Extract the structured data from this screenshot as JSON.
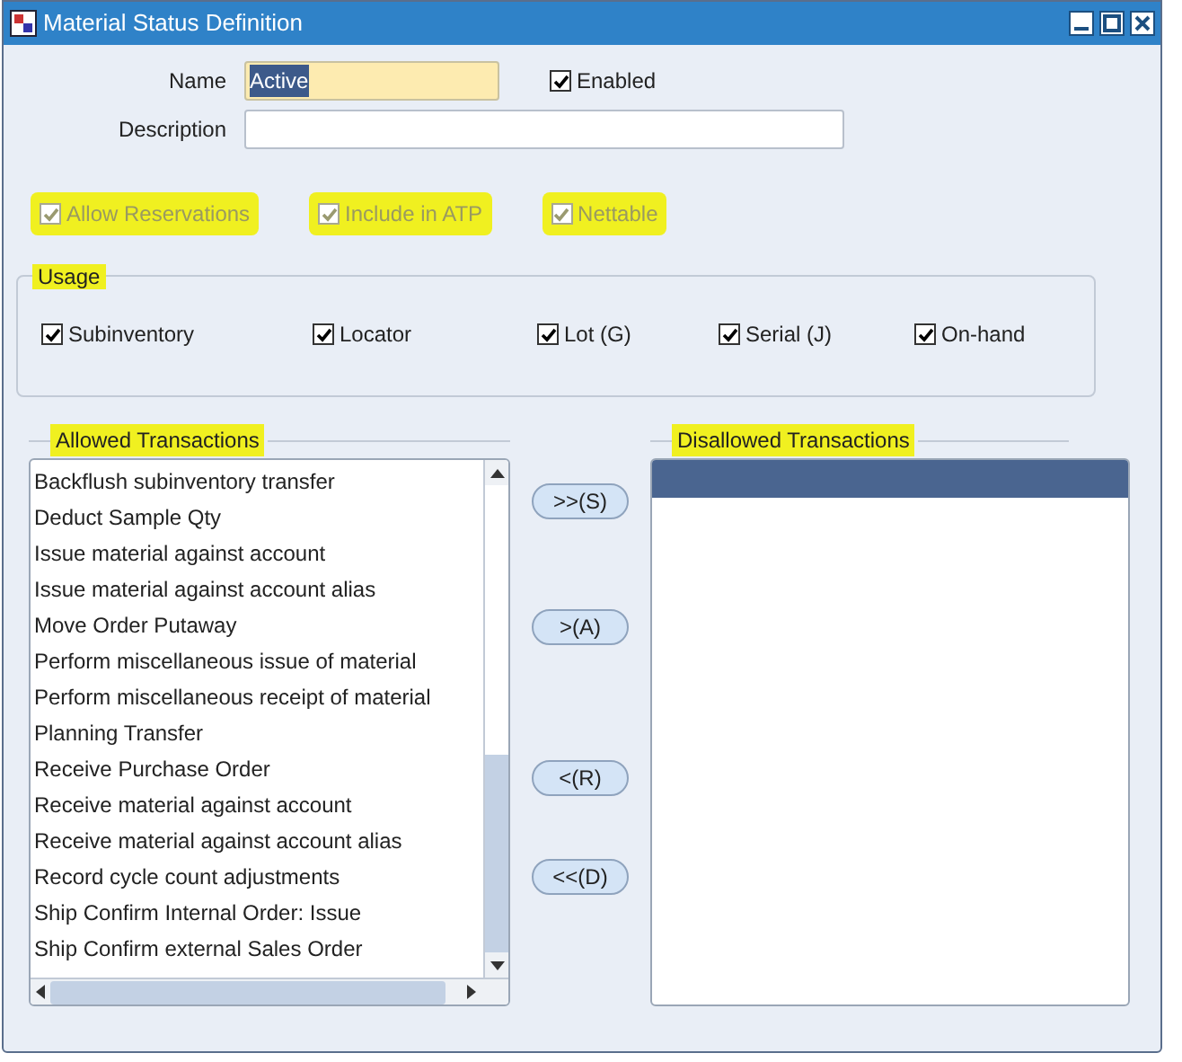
{
  "window": {
    "title": "Material Status Definition"
  },
  "name_field": {
    "label": "Name",
    "value": "Active",
    "text_selected": true
  },
  "enabled": {
    "label": "Enabled",
    "checked": true
  },
  "description_field": {
    "label": "Description"
  },
  "options": [
    {
      "label": "Allow Reservations",
      "checked": true,
      "disabled": true,
      "highlighted": true
    },
    {
      "label": "Include in ATP",
      "checked": true,
      "disabled": true,
      "highlighted": true
    },
    {
      "label": "Nettable",
      "checked": true,
      "disabled": true,
      "highlighted": true
    }
  ],
  "usage": {
    "title": "Usage",
    "highlighted": true,
    "items": [
      {
        "label": "Subinventory",
        "checked": true
      },
      {
        "label": "Locator",
        "checked": true
      },
      {
        "label": "Lot (G)",
        "checked": true
      },
      {
        "label": "Serial (J)",
        "checked": true
      },
      {
        "label": "On-hand",
        "checked": true
      }
    ]
  },
  "allowed": {
    "title": "Allowed Transactions",
    "highlighted": true,
    "items": [
      "Backflush subinventory transfer",
      "Deduct Sample Qty",
      "Issue material against account",
      "Issue material against account alias",
      "Move Order Putaway",
      "Perform miscellaneous issue of material",
      "Perform miscellaneous receipt of material",
      "Planning Transfer",
      "Receive Purchase Order",
      "Receive material against account",
      "Receive material against account alias",
      "Record cycle count adjustments",
      "Ship Confirm Internal Order: Issue",
      "Ship Confirm external Sales Order"
    ]
  },
  "buttons": [
    ">>(S)",
    ">(A)",
    "<(R)",
    "<<(D)"
  ],
  "disallowed": {
    "title": "Disallowed Transactions",
    "highlighted": true
  }
}
